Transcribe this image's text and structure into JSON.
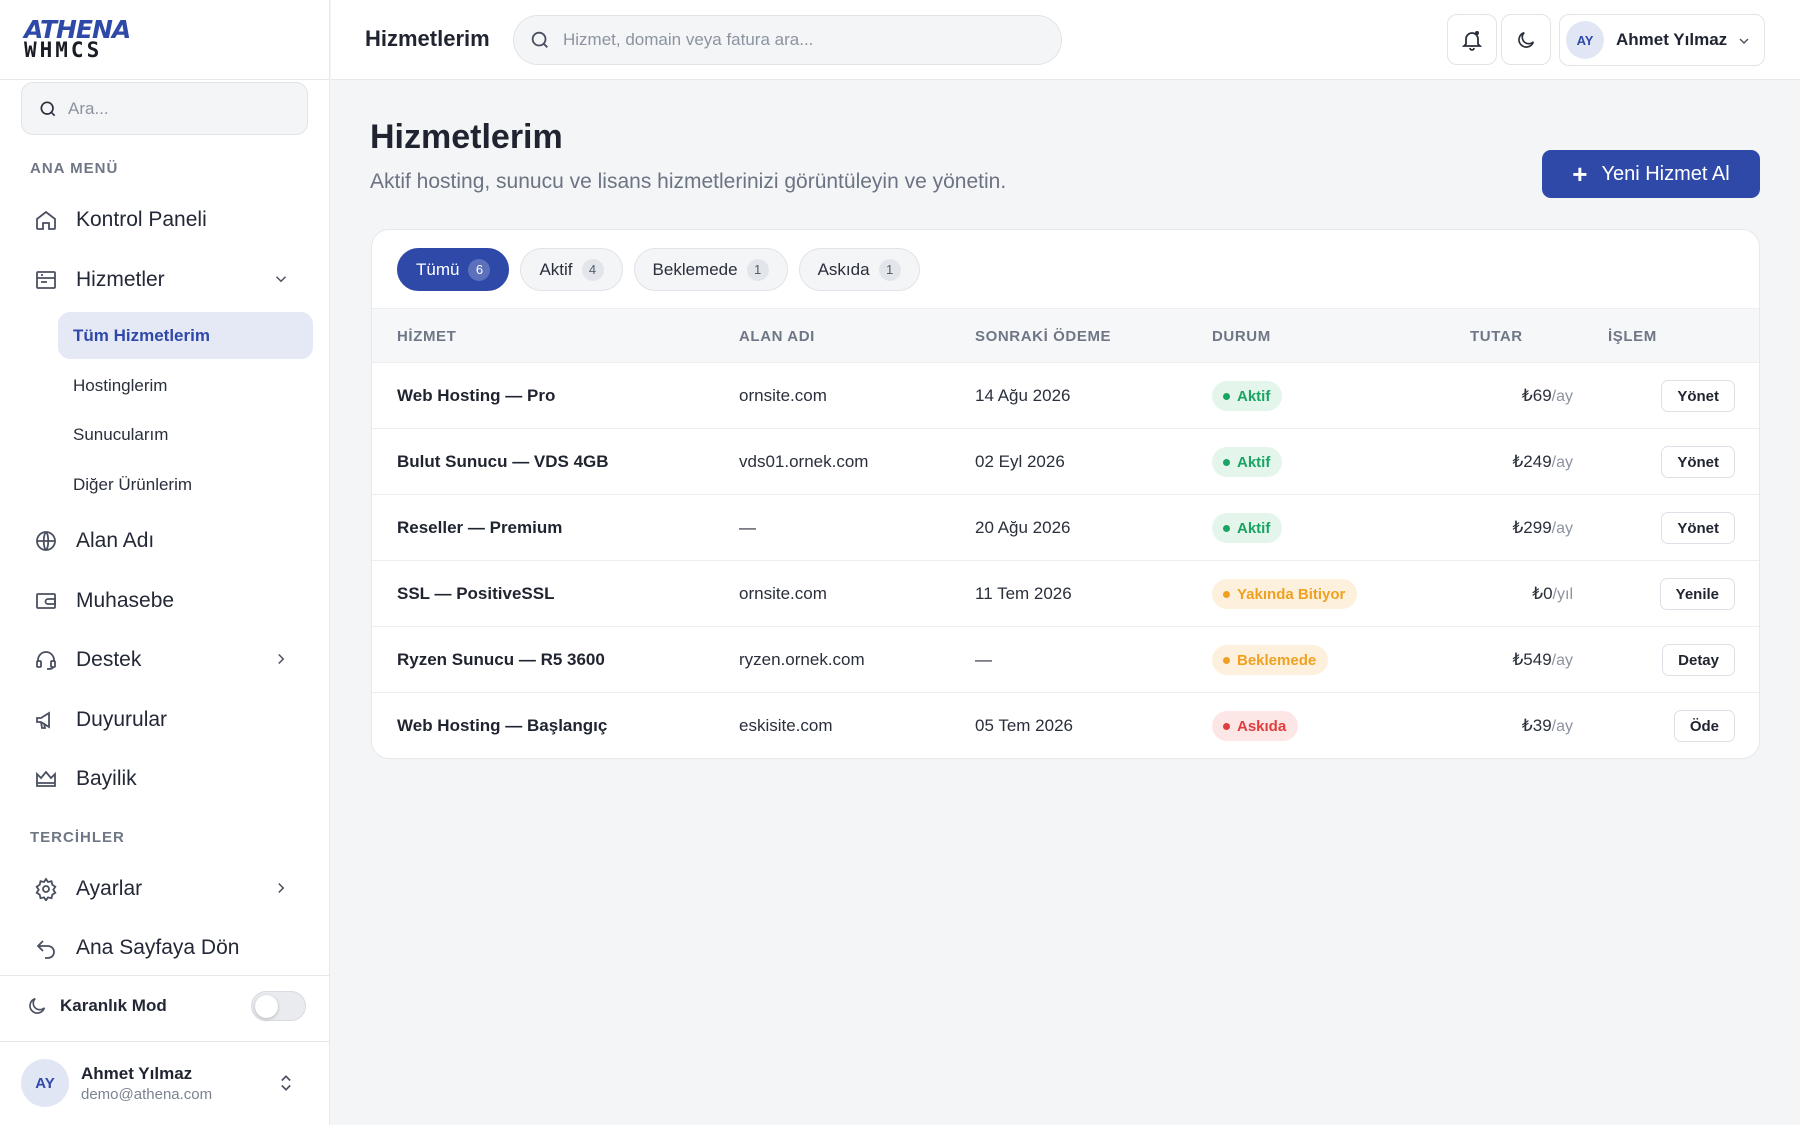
{
  "logo": {
    "line1": "ATHENA",
    "line2": "WHMCS"
  },
  "sidebar": {
    "search_placeholder": "Ara...",
    "section_main": "ANA MENÜ",
    "section_prefs": "TERCİHLER",
    "items": {
      "dashboard": "Kontrol Paneli",
      "services": "Hizmetler",
      "domains": "Alan Adı",
      "billing": "Muhasebe",
      "support": "Destek",
      "announcements": "Duyurular",
      "reseller": "Bayilik",
      "settings": "Ayarlar",
      "home": "Ana Sayfaya Dön"
    },
    "sub_items": [
      "Tüm Hizmetlerim",
      "Hostinglerim",
      "Sunucularım",
      "Diğer Ürünlerim"
    ],
    "dark_mode_label": "Karanlık Mod",
    "dark_mode_on": false,
    "user": {
      "initials": "AY",
      "name": "Ahmet Yılmaz",
      "email": "demo@athena.com"
    }
  },
  "topbar": {
    "title": "Hizmetlerim",
    "search_placeholder": "Hizmet, domain veya fatura ara...",
    "user": {
      "initials": "AY",
      "name": "Ahmet Yılmaz"
    }
  },
  "main": {
    "title": "Hizmetlerim",
    "subtitle": "Aktif hosting, sunucu ve lisans hizmetlerinizi görüntüleyin ve yönetin.",
    "new_button": "Yeni Hizmet Al",
    "tabs": [
      {
        "label": "Tümü",
        "count": "6"
      },
      {
        "label": "Aktif",
        "count": "4"
      },
      {
        "label": "Beklemede",
        "count": "1"
      },
      {
        "label": "Askıda",
        "count": "1"
      }
    ],
    "columns": [
      "HİZMET",
      "ALAN ADI",
      "SONRAKİ ÖDEME",
      "DURUM",
      "TUTAR",
      "İŞLEM"
    ],
    "rows": [
      {
        "service": "Web Hosting — Pro",
        "domain": "ornsite.com",
        "next": "14 Ağu 2026",
        "status": "Aktif",
        "status_color": "#1aa463",
        "amount": "₺69",
        "period": "/ay",
        "action": "Yönet"
      },
      {
        "service": "Bulut Sunucu — VDS 4GB",
        "domain": "vds01.ornek.com",
        "next": "02 Eyl 2026",
        "status": "Aktif",
        "status_color": "#1aa463",
        "amount": "₺249",
        "period": "/ay",
        "action": "Yönet"
      },
      {
        "service": "Reseller — Premium",
        "domain": "—",
        "next": "20 Ağu 2026",
        "status": "Aktif",
        "status_color": "#1aa463",
        "amount": "₺299",
        "period": "/ay",
        "action": "Yönet"
      },
      {
        "service": "SSL — PositiveSSL",
        "domain": "ornsite.com",
        "next": "11 Tem 2026",
        "status": "Yakında Bitiyor",
        "status_color": "#f0a020",
        "amount": "₺0",
        "period": "/yıl",
        "action": "Yenile"
      },
      {
        "service": "Ryzen Sunucu — R5 3600",
        "domain": "ryzen.ornek.com",
        "next": "—",
        "status": "Beklemede",
        "status_color": "#f0a020",
        "amount": "₺549",
        "period": "/ay",
        "action": "Detay"
      },
      {
        "service": "Web Hosting — Başlangıç",
        "domain": "eskisite.com",
        "next": "05 Tem 2026",
        "status": "Askıda",
        "status_color": "#e23d3d",
        "amount": "₺39",
        "period": "/ay",
        "action": "Öde"
      }
    ]
  }
}
